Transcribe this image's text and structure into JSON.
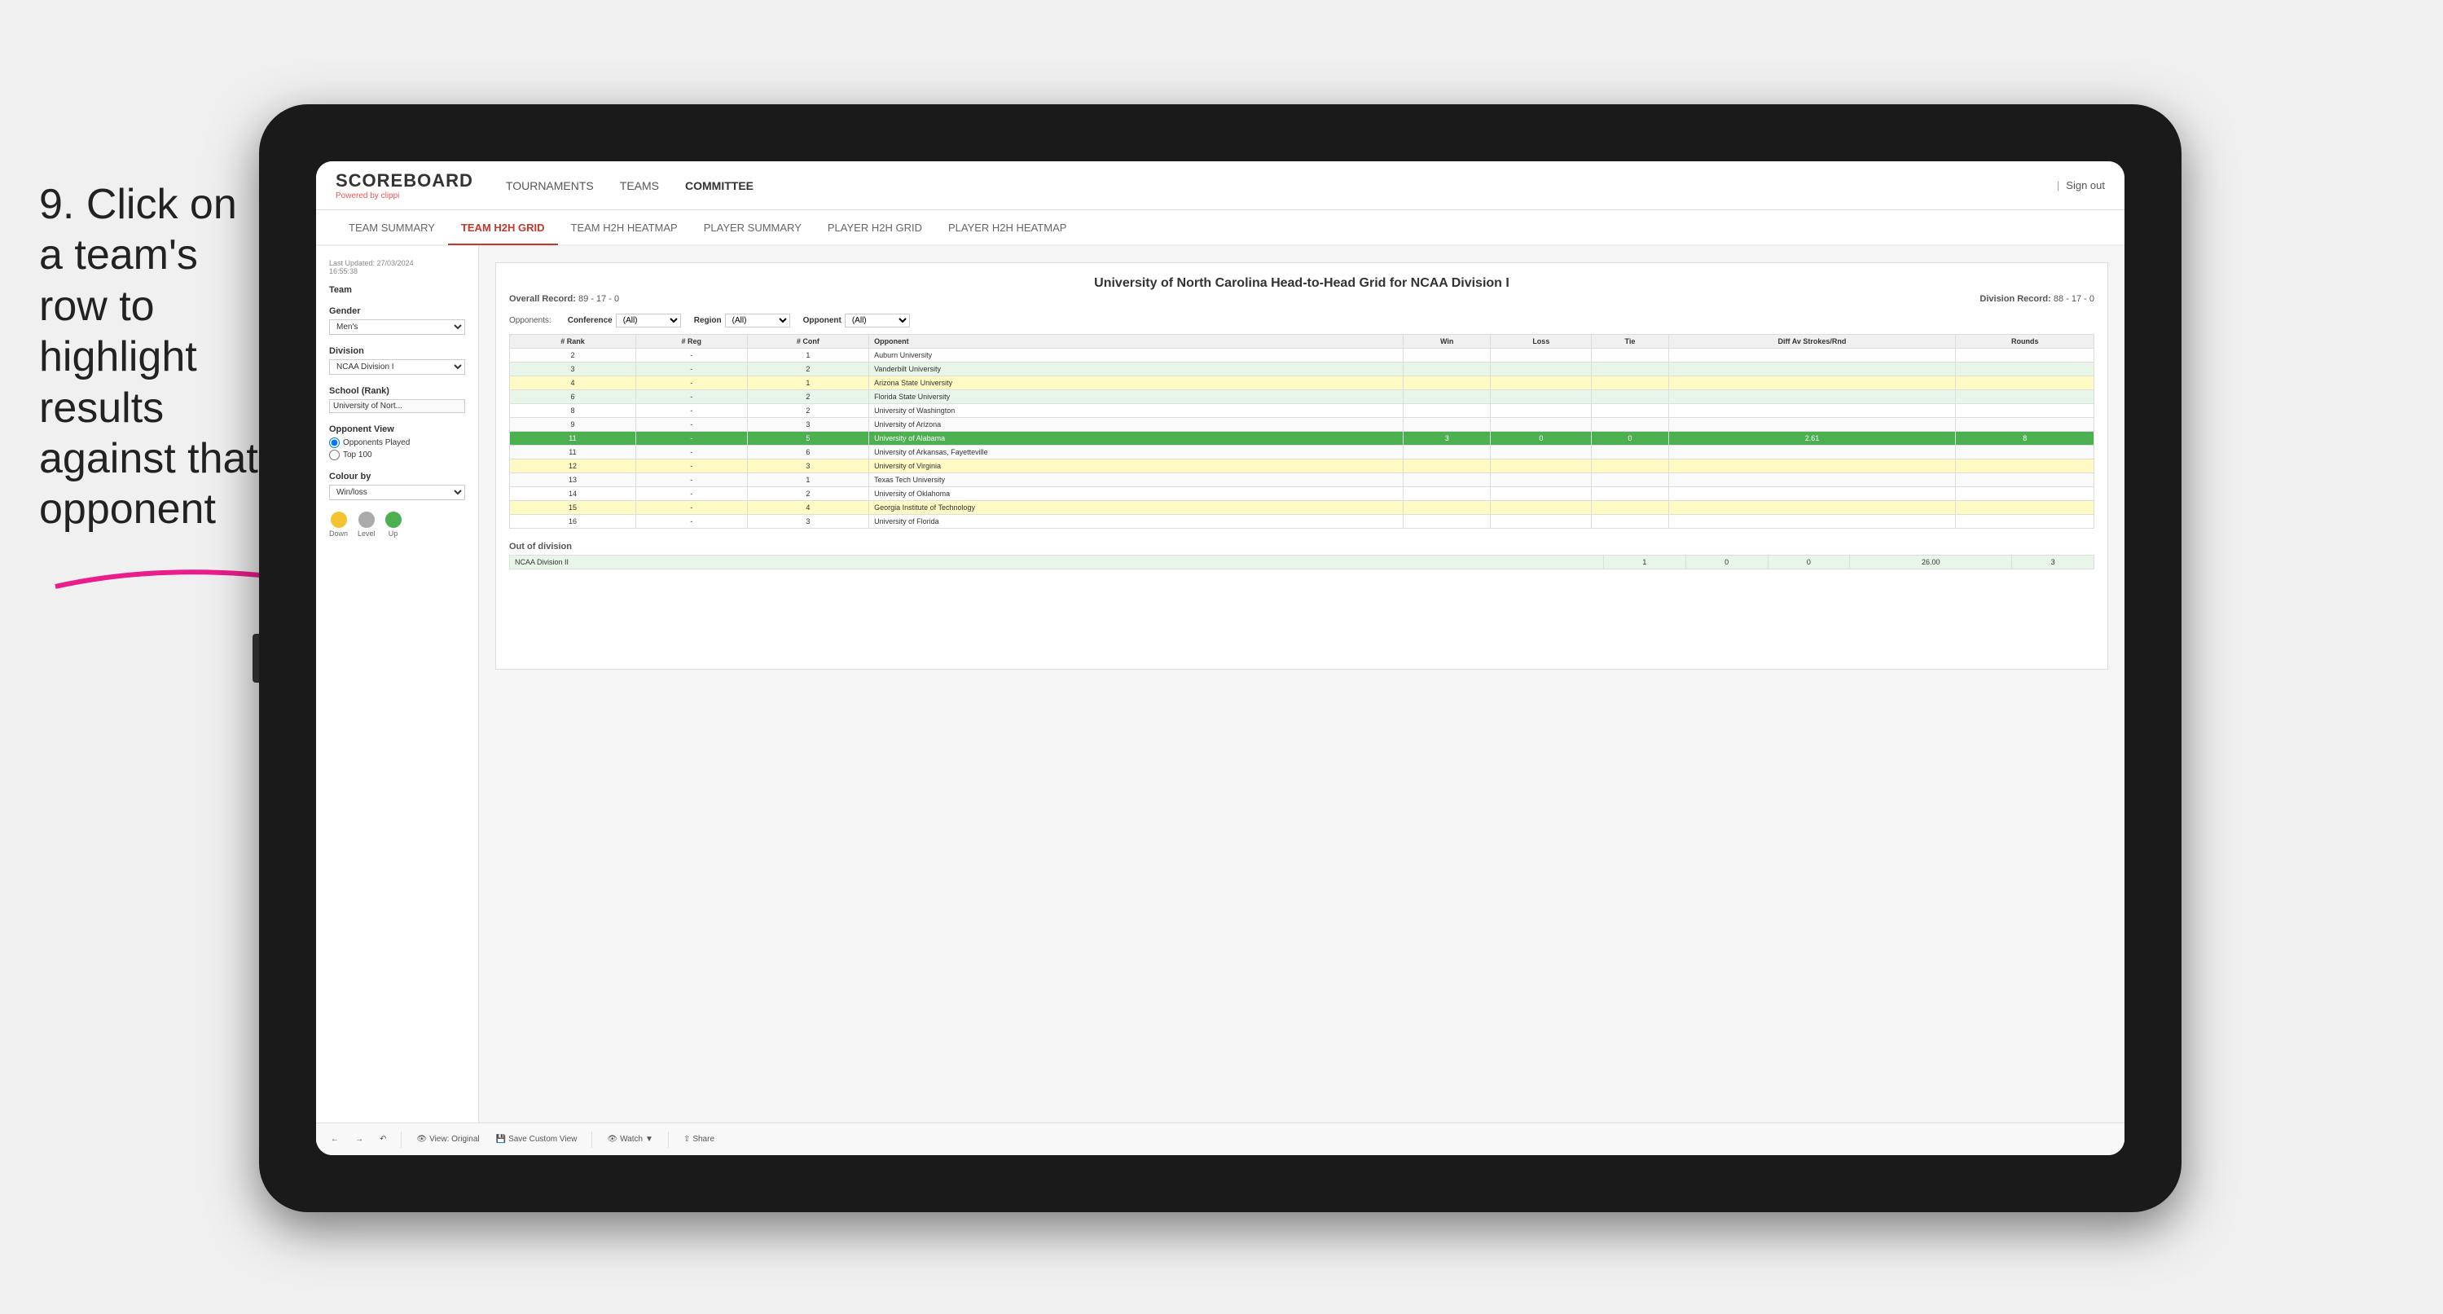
{
  "instruction": {
    "text": "9. Click on a team's row to highlight results against that opponent"
  },
  "nav": {
    "logo": "SCOREBOARD",
    "powered_by": "Powered by",
    "brand": "clippi",
    "items": [
      "TOURNAMENTS",
      "TEAMS",
      "COMMITTEE"
    ],
    "sign_out": "Sign out"
  },
  "sub_nav": {
    "items": [
      "TEAM SUMMARY",
      "TEAM H2H GRID",
      "TEAM H2H HEATMAP",
      "PLAYER SUMMARY",
      "PLAYER H2H GRID",
      "PLAYER H2H HEATMAP"
    ],
    "active": "TEAM H2H GRID"
  },
  "sidebar": {
    "last_updated_label": "Last Updated: 27/03/2024",
    "time": "16:55:38",
    "team_label": "Team",
    "gender_label": "Gender",
    "gender_value": "Men's",
    "division_label": "Division",
    "division_value": "NCAA Division I",
    "school_label": "School (Rank)",
    "school_value": "University of Nort...",
    "opponent_view_label": "Opponent View",
    "opponents_played": "Opponents Played",
    "top_100": "Top 100",
    "colour_by_label": "Colour by",
    "colour_by_value": "Win/loss",
    "legend": {
      "down_label": "Down",
      "level_label": "Level",
      "up_label": "Up"
    }
  },
  "grid": {
    "title": "University of North Carolina Head-to-Head Grid for NCAA Division I",
    "overall_record_label": "Overall Record:",
    "overall_record": "89 - 17 - 0",
    "division_record_label": "Division Record:",
    "division_record": "88 - 17 - 0",
    "filters": {
      "conference_label": "Conference",
      "conference_value": "(All)",
      "region_label": "Region",
      "region_value": "(All)",
      "opponent_label": "Opponent",
      "opponent_value": "(All)",
      "opponents_label": "Opponents:"
    },
    "columns": [
      "# Rank",
      "# Reg",
      "# Conf",
      "Opponent",
      "Win",
      "Loss",
      "Tie",
      "Diff Av Strokes/Rnd",
      "Rounds"
    ],
    "rows": [
      {
        "rank": "2",
        "reg": "-",
        "conf": "1",
        "opponent": "Auburn University",
        "win": "",
        "loss": "",
        "tie": "",
        "diff": "",
        "rounds": "",
        "style": "normal"
      },
      {
        "rank": "3",
        "reg": "-",
        "conf": "2",
        "opponent": "Vanderbilt University",
        "win": "",
        "loss": "",
        "tie": "",
        "diff": "",
        "rounds": "",
        "style": "light-green"
      },
      {
        "rank": "4",
        "reg": "-",
        "conf": "1",
        "opponent": "Arizona State University",
        "win": "",
        "loss": "",
        "tie": "",
        "diff": "",
        "rounds": "",
        "style": "light-yellow"
      },
      {
        "rank": "6",
        "reg": "-",
        "conf": "2",
        "opponent": "Florida State University",
        "win": "",
        "loss": "",
        "tie": "",
        "diff": "",
        "rounds": "",
        "style": "light-green"
      },
      {
        "rank": "8",
        "reg": "-",
        "conf": "2",
        "opponent": "University of Washington",
        "win": "",
        "loss": "",
        "tie": "",
        "diff": "",
        "rounds": "",
        "style": "normal"
      },
      {
        "rank": "9",
        "reg": "-",
        "conf": "3",
        "opponent": "University of Arizona",
        "win": "",
        "loss": "",
        "tie": "",
        "diff": "",
        "rounds": "",
        "style": "normal"
      },
      {
        "rank": "11",
        "reg": "-",
        "conf": "5",
        "opponent": "University of Alabama",
        "win": "3",
        "loss": "0",
        "tie": "0",
        "diff": "2.61",
        "rounds": "8",
        "style": "highlighted"
      },
      {
        "rank": "11",
        "reg": "-",
        "conf": "6",
        "opponent": "University of Arkansas, Fayetteville",
        "win": "",
        "loss": "",
        "tie": "",
        "diff": "",
        "rounds": "",
        "style": "normal"
      },
      {
        "rank": "12",
        "reg": "-",
        "conf": "3",
        "opponent": "University of Virginia",
        "win": "",
        "loss": "",
        "tie": "",
        "diff": "",
        "rounds": "",
        "style": "light-yellow"
      },
      {
        "rank": "13",
        "reg": "-",
        "conf": "1",
        "opponent": "Texas Tech University",
        "win": "",
        "loss": "",
        "tie": "",
        "diff": "",
        "rounds": "",
        "style": "normal"
      },
      {
        "rank": "14",
        "reg": "-",
        "conf": "2",
        "opponent": "University of Oklahoma",
        "win": "",
        "loss": "",
        "tie": "",
        "diff": "",
        "rounds": "",
        "style": "normal"
      },
      {
        "rank": "15",
        "reg": "-",
        "conf": "4",
        "opponent": "Georgia Institute of Technology",
        "win": "",
        "loss": "",
        "tie": "",
        "diff": "",
        "rounds": "",
        "style": "light-yellow"
      },
      {
        "rank": "16",
        "reg": "-",
        "conf": "3",
        "opponent": "University of Florida",
        "win": "",
        "loss": "",
        "tie": "",
        "diff": "",
        "rounds": "",
        "style": "normal"
      }
    ],
    "out_of_division_label": "Out of division",
    "out_of_division_row": {
      "division": "NCAA Division II",
      "win": "1",
      "loss": "0",
      "tie": "0",
      "diff": "26.00",
      "rounds": "3"
    }
  },
  "toolbar": {
    "view_original": "View: Original",
    "save_custom_view": "Save Custom View",
    "watch": "Watch",
    "share": "Share"
  },
  "colors": {
    "accent_red": "#c0392b",
    "highlight_green": "#4caf50",
    "light_green": "#e8f5e9",
    "light_yellow": "#fff9c4",
    "legend_down": "#f4c430",
    "legend_level": "#aaaaaa",
    "legend_up": "#4caf50"
  }
}
